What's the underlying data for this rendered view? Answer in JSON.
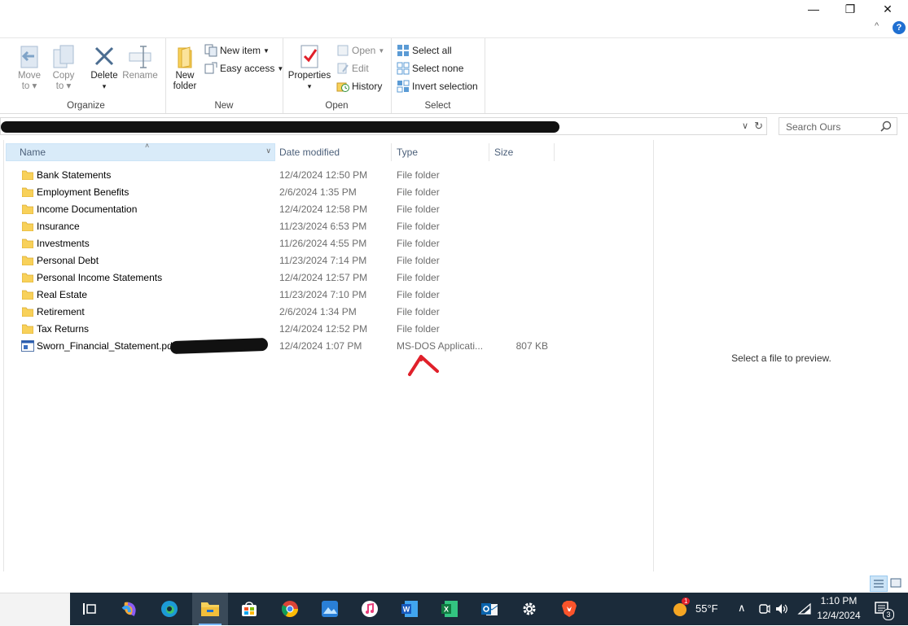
{
  "window": {
    "minimize_label": "—",
    "restore_label": "❐",
    "close_label": "✕",
    "collapse_label": "^",
    "help_label": "?"
  },
  "ribbon": {
    "organize": {
      "label": "Organize",
      "move_to": [
        "Move",
        "to ▾"
      ],
      "copy_to": [
        "Copy",
        "to ▾"
      ],
      "delete": [
        "Delete",
        "▾"
      ],
      "rename": "Rename"
    },
    "new": {
      "label": "New",
      "new_folder": [
        "New",
        "folder"
      ],
      "new_item": "New item",
      "easy_access": "Easy access"
    },
    "open": {
      "label": "Open",
      "properties": [
        "Properties",
        "▾"
      ],
      "open": "Open",
      "edit": "Edit",
      "history": "History"
    },
    "select": {
      "label": "Select",
      "select_all": "Select all",
      "select_none": "Select none",
      "invert_selection": "Invert selection"
    }
  },
  "address": {
    "dropdown": "∨",
    "refresh": "↻"
  },
  "search": {
    "placeholder": "Search Ours"
  },
  "columns": {
    "name": "Name",
    "date": "Date modified",
    "type": "Type",
    "size": "Size",
    "sort_indicator": "˄",
    "header_dropdown": "∨"
  },
  "files": [
    {
      "name": "Bank Statements",
      "date": "12/4/2024 12:50 PM",
      "type": "File folder",
      "size": ""
    },
    {
      "name": "Employment Benefits",
      "date": "2/6/2024 1:35 PM",
      "type": "File folder",
      "size": ""
    },
    {
      "name": "Income Documentation",
      "date": "12/4/2024 12:58 PM",
      "type": "File folder",
      "size": ""
    },
    {
      "name": "Insurance",
      "date": "11/23/2024 6:53 PM",
      "type": "File folder",
      "size": ""
    },
    {
      "name": "Investments",
      "date": "11/26/2024 4:55 PM",
      "type": "File folder",
      "size": ""
    },
    {
      "name": "Personal Debt",
      "date": "11/23/2024 7:14 PM",
      "type": "File folder",
      "size": ""
    },
    {
      "name": "Personal Income Statements",
      "date": "12/4/2024 12:57 PM",
      "type": "File folder",
      "size": ""
    },
    {
      "name": "Real Estate",
      "date": "11/23/2024 7:10 PM",
      "type": "File folder",
      "size": ""
    },
    {
      "name": "Retirement",
      "date": "2/6/2024 1:34 PM",
      "type": "File folder",
      "size": ""
    },
    {
      "name": "Tax Returns",
      "date": "12/4/2024 12:52 PM",
      "type": "File folder",
      "size": ""
    },
    {
      "name": "Sworn_Financial_Statement.pdf",
      "date": "12/4/2024 1:07 PM",
      "type": "MS-DOS Applicati...",
      "size": "807 KB"
    }
  ],
  "preview": {
    "message": "Select a file to preview."
  },
  "taskbar": {
    "weather_temp": "55°F",
    "weather_badge": "1",
    "time": "1:10 PM",
    "date": "12/4/2024",
    "notification_count": "3",
    "tray_chevron": "∧"
  },
  "colors": {
    "accent_blue": "#1f6fd1",
    "header_selected": "#d9ebf9",
    "taskbar_bg": "#1b2b3a",
    "annotation_red": "#e0202a",
    "folder_yellow": "#f8d15a"
  }
}
